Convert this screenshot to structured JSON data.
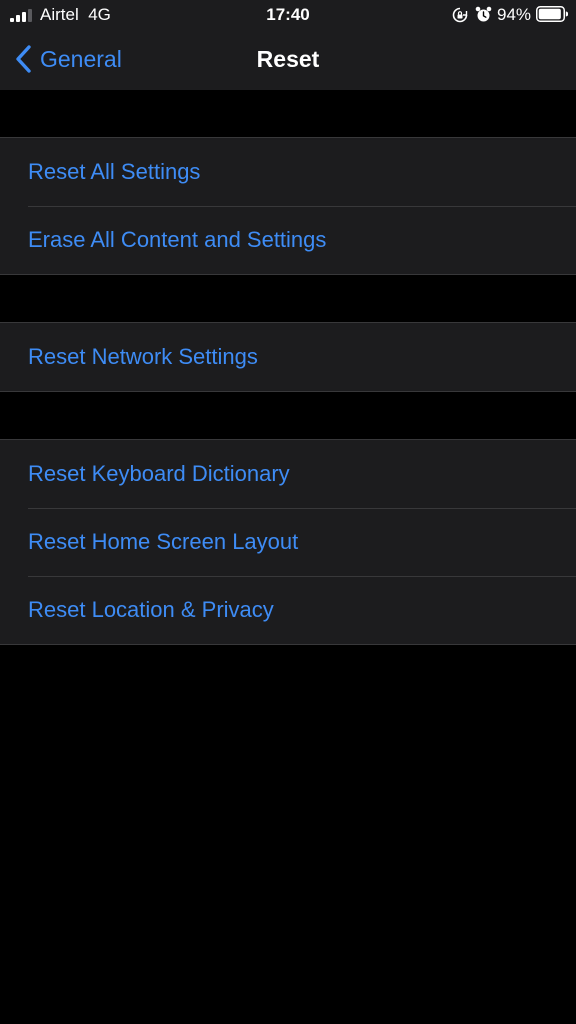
{
  "status_bar": {
    "carrier": "Airtel",
    "network": "4G",
    "time": "17:40",
    "battery_percent": "94%",
    "battery_level": 0.94,
    "icons": [
      "signal-bars-icon",
      "rotation-lock-icon",
      "alarm-icon",
      "battery-icon"
    ]
  },
  "nav": {
    "back_label": "General",
    "title": "Reset"
  },
  "groups": [
    {
      "items": [
        {
          "label": "Reset All Settings"
        },
        {
          "label": "Erase All Content and Settings"
        }
      ]
    },
    {
      "items": [
        {
          "label": "Reset Network Settings"
        }
      ]
    },
    {
      "items": [
        {
          "label": "Reset Keyboard Dictionary"
        },
        {
          "label": "Reset Home Screen Layout"
        },
        {
          "label": "Reset Location & Privacy"
        }
      ]
    }
  ],
  "colors": {
    "accent": "#3e8cf5",
    "background": "#000000",
    "cell_background": "#1c1c1e",
    "separator": "#38383a",
    "text": "#ffffff"
  }
}
